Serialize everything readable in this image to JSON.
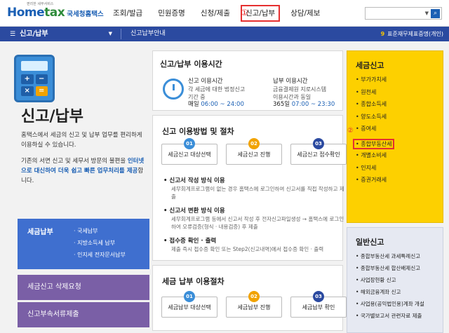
{
  "header": {
    "logo_tiny": "편리한 세무서비스",
    "logo_brand_a": "Home",
    "logo_brand_b": "tax",
    "logo_sub": "국세청홈택스",
    "menu": [
      "조회/발급",
      "민원증명",
      "신청/제출",
      "신고/납부",
      "상담/제보"
    ],
    "marker1": "①",
    "marker2": "②"
  },
  "nav": {
    "title": "신고/납부",
    "sub": "신고납부안내",
    "right_num": "9",
    "right_label": "표준재무제표증명(개인)"
  },
  "intro": {
    "title": "신고/납부",
    "desc1": "홈택스에서 세금의 신고 및 납부 업무를 편리하게 이용하실 수 있습니다.",
    "desc2_a": "기존의 서면 신고 및 세무서 방문의 불편을 ",
    "desc2_em": "인터넷으로 대신하여 더욱 쉽고 빠른 업무처리를 제공",
    "desc2_b": "합니다."
  },
  "left_nav": {
    "title": "세금납부",
    "items": [
      "· 국세납부",
      "· 지방소득세 납부",
      "· 인지세 전자문서납부"
    ],
    "btn1": "세금신고 삭제요청",
    "btn2": "신고부속서류제출"
  },
  "card_time": {
    "title": "신고/납부 이용시간",
    "col1": {
      "h": "신고 이용시간",
      "d": "각 세금에 대한 법정신고",
      "d2": "기간 중",
      "time_a": "매일 ",
      "time_b": "06:00 ~ 24:00"
    },
    "col2": {
      "h": "납부 이용시간",
      "d": "금융결제원 지로시스템",
      "d2": "이용시간과 동일",
      "time_a": "365일 ",
      "time_b": "07:00 ~ 23:30"
    }
  },
  "card_method": {
    "title": "신고 이용방법 및 절차",
    "steps": [
      {
        "n": "01",
        "label": "세금신고 대상선택"
      },
      {
        "n": "02",
        "label": "세금신고 진행"
      },
      {
        "n": "03",
        "label": "세금신고 접수확인"
      }
    ],
    "b1": "신고서 작성 방식 이용",
    "b1d": "세무회계프로그램이 없는 경우 홈택스에 로그인하여 신고서를 직접 작성하고 제출",
    "b2": "신고서 변환 방식 이용",
    "b2d": "세무회계프로그램 등에서 신고서 작성 후 전자신고파일생성 → 홈택스에 로그인하여 오류검증(형식 · 내용검증) 후 제출",
    "b3": "접수증 확인 · 출력",
    "b3d": "제출 즉시 접수증 확인 또는 Step2(신고내역)에서 접수증 확인 · 출력"
  },
  "card_pay": {
    "title": "세금 납부 이용절차",
    "steps": [
      {
        "n": "01",
        "label": "세금납부 대상선택"
      },
      {
        "n": "02",
        "label": "세금납부 진행"
      },
      {
        "n": "03",
        "label": "세금납부 확인"
      }
    ]
  },
  "right_tax": {
    "title": "세금신고",
    "items": [
      "부가가치세",
      "원천세",
      "종합소득세",
      "양도소득세",
      "증여세",
      "종합부동산세",
      "개별소비세",
      "인지세",
      "증권거래세"
    ],
    "highlight_index": 5
  },
  "right_general": {
    "title": "일반신고",
    "items": [
      "종합부동산세 과세특례신고",
      "종합부동산세 합산배제신고",
      "사업장현황 신고",
      "해외금융계좌 신고",
      "사업용(공익법인용)계좌 개설",
      "국가별보고서 관련자료 제출"
    ]
  },
  "colors": {
    "accent": "#2b4aa0",
    "highlight": "#e53030",
    "yellow": "#fdd000"
  },
  "icons": {
    "calc": "calculator-icon",
    "clock": "clock-icon",
    "search": "search-icon"
  }
}
